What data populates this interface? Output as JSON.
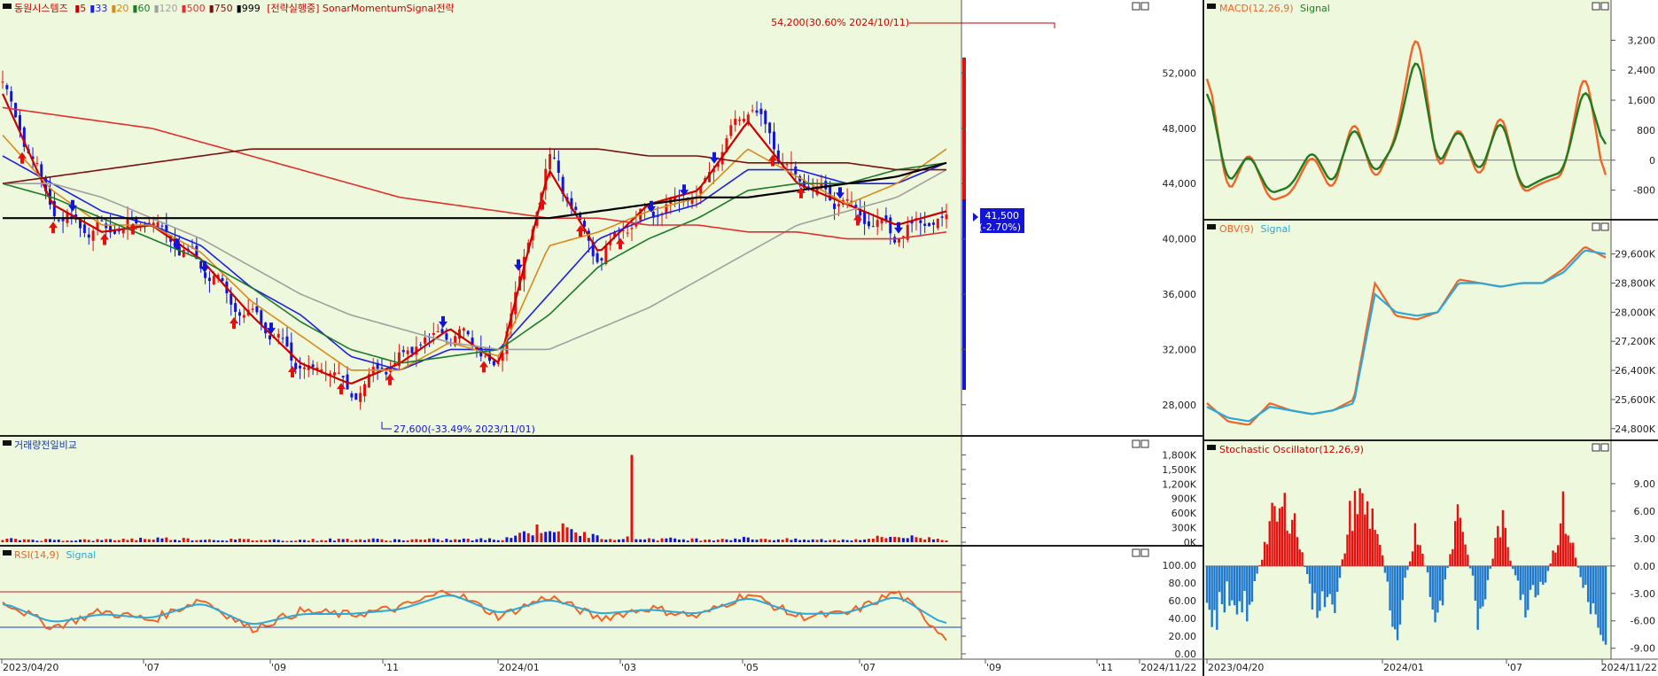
{
  "stock": {
    "name": "동원시스템즈",
    "ma_legend": [
      {
        "label": "5",
        "color": "#cc0000"
      },
      {
        "label": "33",
        "color": "#1f1fe0"
      },
      {
        "label": "20",
        "color": "#d98a1a"
      },
      {
        "label": "60",
        "color": "#1d7a2a"
      },
      {
        "label": "120",
        "color": "#a0a0a0"
      },
      {
        "label": "500",
        "color": "#e03030"
      },
      {
        "label": "750",
        "color": "#7a1010"
      },
      {
        "label": "999",
        "color": "#000000"
      }
    ],
    "strategy": "[전략실행중] SonarMomentumSignal전략",
    "current_price": "41,500",
    "change": "(-2.70%)",
    "high_annotation": "54,200(30.60% 2024/10/11)",
    "low_annotation": "27,600(-33.49% 2023/11/01)"
  },
  "panels": {
    "volume_title": "거래량전일비교",
    "rsi_title": "RSI(14,9)",
    "rsi_signal": "Signal",
    "macd_title": "MACD(12,26,9)",
    "macd_signal": "Signal",
    "obv_title": "OBV(9)",
    "obv_signal": "Signal",
    "stoch_title": "Stochastic Oscillator(12,26,9)"
  },
  "dates": {
    "main": [
      "2023/04/20",
      "'07",
      "'09",
      "'11",
      "2024/01",
      "'03",
      "'05",
      "'07",
      "'09",
      "'11",
      "2024/11/22"
    ],
    "right": [
      "2023/04/20",
      "2024/01",
      "'07",
      "2024/11/22"
    ]
  },
  "colors": {
    "bg": "#eef8dc",
    "up": "#e41010",
    "down": "#1414d8",
    "line_main": "#f06428",
    "line_signal": "#2aa8d8",
    "macd_signal": "#1f7a1f"
  },
  "axes": {
    "price": [
      "52,000",
      "48,000",
      "44,000",
      "40,000",
      "36,000",
      "32,000",
      "28,000"
    ],
    "volume": [
      "1,800K",
      "1,500K",
      "1,200K",
      "900K",
      "600K",
      "300K",
      "0K"
    ],
    "rsi": [
      "100.00",
      "80.00",
      "60.00",
      "40.00",
      "20.00",
      "0.00"
    ],
    "macd": [
      "3,200",
      "2,400",
      "1,600",
      "800",
      "0",
      "-800"
    ],
    "obv": [
      "29,600K",
      "28,800K",
      "28,000K",
      "27,200K",
      "26,400K",
      "25,600K",
      "24,800K"
    ],
    "stoch": [
      "9.00",
      "6.00",
      "3.00",
      "0.00",
      "-3.00",
      "-6.00",
      "-9.00"
    ]
  },
  "chart_data": [
    {
      "type": "candlestick",
      "panel": "price",
      "ylim": [
        26000,
        56000
      ],
      "x": [
        "2023/04",
        "2023/05",
        "2023/06",
        "2023/07",
        "2023/08",
        "2023/09",
        "2023/10",
        "2023/11",
        "2023/12",
        "2024/01",
        "2024/02",
        "2024/03",
        "2024/04",
        "2024/05",
        "2024/06",
        "2024/07",
        "2024/08",
        "2024/09",
        "2024/10",
        "2024/11"
      ],
      "close": [
        51500,
        42000,
        40500,
        41500,
        38000,
        34500,
        31000,
        29000,
        31500,
        33500,
        31000,
        46500,
        38500,
        42500,
        43000,
        49500,
        44000,
        42500,
        40500,
        41500
      ],
      "series": [
        {
          "name": "5",
          "values": [
            50500,
            42500,
            40500,
            41000,
            38500,
            34500,
            31000,
            29500,
            31000,
            33500,
            31000,
            45000,
            39000,
            42500,
            43500,
            48500,
            44000,
            42500,
            41000,
            42000
          ]
        },
        {
          "name": "33",
          "values": [
            46000,
            44000,
            42000,
            41000,
            39500,
            36500,
            34500,
            31500,
            30500,
            32000,
            32000,
            36000,
            40000,
            41500,
            42500,
            45000,
            45000,
            44000,
            44000,
            45500
          ]
        },
        {
          "name": "20",
          "values": [
            47500,
            43500,
            41000,
            41000,
            39000,
            35500,
            33000,
            30500,
            30500,
            32500,
            31500,
            39500,
            40500,
            42000,
            43000,
            46500,
            44500,
            42500,
            44000,
            46500
          ]
        },
        {
          "name": "60",
          "values": [
            44000,
            43000,
            41500,
            40000,
            38500,
            36500,
            34000,
            32000,
            31000,
            31500,
            32000,
            34500,
            38000,
            40000,
            41500,
            43500,
            44000,
            44000,
            45000,
            45500
          ]
        },
        {
          "name": "120",
          "values": [
            44000,
            44000,
            43000,
            41500,
            40000,
            38000,
            36000,
            34500,
            33500,
            32500,
            32000,
            32000,
            33500,
            35000,
            37000,
            39000,
            41000,
            42000,
            43000,
            45000
          ]
        },
        {
          "name": "500",
          "values": [
            49500,
            49000,
            48500,
            48000,
            47000,
            46000,
            45000,
            44000,
            43000,
            42500,
            42000,
            41500,
            41500,
            41000,
            41000,
            40500,
            40500,
            40000,
            40000,
            40500
          ]
        },
        {
          "name": "750",
          "values": [
            44000,
            44500,
            45000,
            45500,
            46000,
            46500,
            46500,
            46500,
            46500,
            46500,
            46500,
            46500,
            46500,
            46000,
            46000,
            45500,
            45500,
            45500,
            45000,
            45000
          ]
        },
        {
          "name": "999",
          "values": [
            41500,
            41500,
            41500,
            41500,
            41500,
            41500,
            41500,
            41500,
            41500,
            41500,
            41500,
            41500,
            42000,
            42500,
            43000,
            43000,
            43500,
            44000,
            44500,
            45500
          ]
        }
      ]
    },
    {
      "type": "bar",
      "panel": "volume",
      "ylim": [
        0,
        1900
      ],
      "x": [
        "2023/04",
        "2023/05",
        "2023/06",
        "2023/07",
        "2023/08",
        "2023/09",
        "2023/10",
        "2023/11",
        "2023/12",
        "2024/01",
        "2024/02",
        "2024/03",
        "2024/04",
        "2024/05",
        "2024/06",
        "2024/07",
        "2024/08",
        "2024/09",
        "2024/10",
        "2024/11"
      ],
      "values": [
        60,
        50,
        45,
        80,
        60,
        50,
        45,
        60,
        50,
        55,
        60,
        330,
        100,
        70,
        60,
        80,
        50,
        50,
        120,
        60
      ],
      "peak": 1800
    },
    {
      "type": "line",
      "panel": "rsi",
      "ylim": [
        0,
        100
      ],
      "x": [
        "2023/04",
        "2023/05",
        "2023/06",
        "2023/07",
        "2023/08",
        "2023/09",
        "2023/10",
        "2023/11",
        "2023/12",
        "2024/01",
        "2024/02",
        "2024/03",
        "2024/04",
        "2024/05",
        "2024/06",
        "2024/07",
        "2024/08",
        "2024/09",
        "2024/10",
        "2024/11"
      ],
      "series": [
        {
          "name": "RSI",
          "values": [
            60,
            30,
            48,
            38,
            62,
            28,
            48,
            44,
            52,
            72,
            42,
            65,
            40,
            52,
            42,
            68,
            42,
            45,
            70,
            18
          ]
        },
        {
          "name": "Signal",
          "values": [
            58,
            35,
            45,
            40,
            58,
            32,
            45,
            45,
            50,
            68,
            45,
            62,
            45,
            50,
            45,
            64,
            45,
            46,
            66,
            32
          ]
        }
      ],
      "guides": [
        70,
        30
      ]
    },
    {
      "type": "line",
      "panel": "macd",
      "ylim": [
        -1400,
        3800
      ],
      "x": [
        "2023/04",
        "2023/05",
        "2023/06",
        "2023/07",
        "2023/08",
        "2023/09",
        "2023/10",
        "2023/11",
        "2023/12",
        "2024/01",
        "2024/02",
        "2024/03",
        "2024/04",
        "2024/05",
        "2024/06",
        "2024/07",
        "2024/08",
        "2024/09",
        "2024/10",
        "2024/11"
      ],
      "series": [
        {
          "name": "MACD",
          "values": [
            2600,
            -1000,
            300,
            -1100,
            -900,
            200,
            -900,
            1200,
            -600,
            600,
            3700,
            -400,
            1000,
            -600,
            1400,
            -900,
            -600,
            -400,
            2600,
            -800
          ]
        },
        {
          "name": "Signal",
          "values": [
            2100,
            -700,
            200,
            -900,
            -700,
            300,
            -700,
            1000,
            -400,
            500,
            3000,
            -200,
            900,
            -400,
            1200,
            -800,
            -500,
            -300,
            2100,
            200
          ]
        }
      ]
    },
    {
      "type": "line",
      "panel": "obv",
      "ylim": [
        24600,
        30200
      ],
      "x": [
        "2023/04",
        "2023/05",
        "2023/06",
        "2023/07",
        "2023/08",
        "2023/09",
        "2023/10",
        "2023/11",
        "2023/12",
        "2024/01",
        "2024/02",
        "2024/03",
        "2024/04",
        "2024/05",
        "2024/06",
        "2024/07",
        "2024/08",
        "2024/09",
        "2024/10",
        "2024/11"
      ],
      "series": [
        {
          "name": "OBV",
          "values": [
            25500,
            25000,
            24900,
            25500,
            25300,
            25200,
            25300,
            25600,
            28800,
            27900,
            27800,
            28000,
            28900,
            28800,
            28700,
            28800,
            28800,
            29200,
            29800,
            29500
          ]
        },
        {
          "name": "Signal",
          "values": [
            25400,
            25100,
            25000,
            25400,
            25300,
            25200,
            25300,
            25500,
            28500,
            28000,
            27900,
            28000,
            28800,
            28800,
            28700,
            28800,
            28800,
            29100,
            29700,
            29600
          ]
        }
      ]
    },
    {
      "type": "bar",
      "panel": "stoch",
      "ylim": [
        -10,
        12
      ],
      "x": [
        "2023/04",
        "2023/05",
        "2023/06",
        "2023/07",
        "2023/08",
        "2023/09",
        "2023/10",
        "2023/11",
        "2023/12",
        "2024/01",
        "2024/02",
        "2024/03",
        "2024/04",
        "2024/05",
        "2024/06",
        "2024/07",
        "2024/08",
        "2024/09",
        "2024/10",
        "2024/11"
      ],
      "values": [
        -9,
        -4,
        -6,
        6,
        9,
        -5,
        -7,
        10,
        7,
        -9,
        6,
        -9,
        9,
        -8,
        7,
        -6,
        -4,
        8,
        -4,
        -9
      ]
    }
  ]
}
